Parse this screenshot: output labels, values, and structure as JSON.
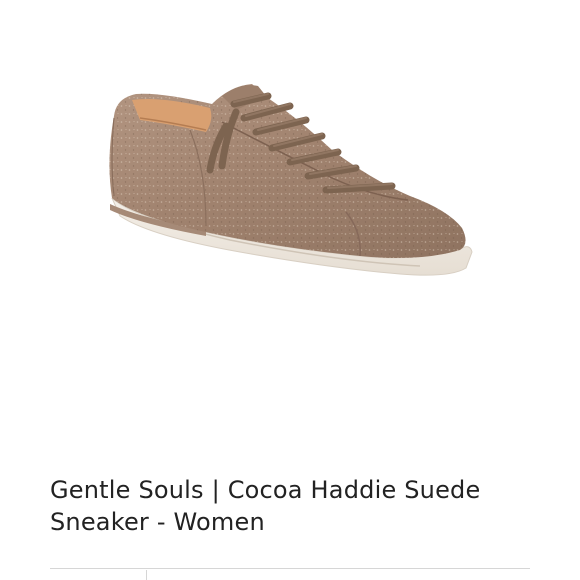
{
  "product": {
    "title": "Gentle Souls | Cocoa Haddie Suede Sneaker - Women",
    "image": {
      "subject": "sneaker-photo",
      "upper_color": "#a48672",
      "sole_color": "#f1ece4",
      "lace_color": "#7d6450",
      "lining_color": "#d9a071"
    }
  }
}
